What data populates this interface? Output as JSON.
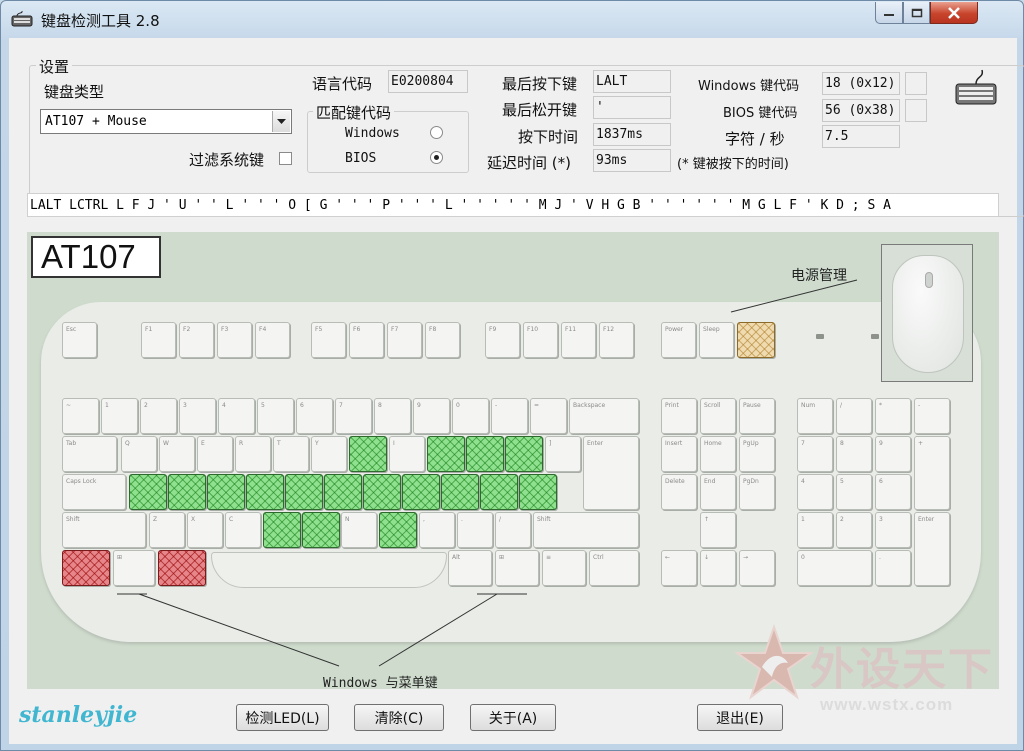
{
  "window": {
    "title": "键盘检测工具 2.8"
  },
  "settings": {
    "legend": "设置",
    "keyboard_type_label": "键盘类型",
    "keyboard_type_value": "AT107 + Mouse",
    "filter_system_keys_label": "过滤系统键",
    "filter_system_keys_checked": false,
    "lang_code_label": "语言代码",
    "lang_code_value": "E0200804",
    "match_legend": "匹配键代码",
    "match_windows_label": "Windows",
    "match_bios_label": "BIOS",
    "match_selected": "BIOS"
  },
  "stats": {
    "last_pressed_label": "最后按下键",
    "last_pressed_value": "LALT",
    "last_released_label": "最后松开键",
    "last_released_value": "'",
    "press_time_label": "按下时间",
    "press_time_value": "1837ms",
    "delay_label": "延迟时间 (*)",
    "delay_value": "93ms",
    "windows_code_label": "Windows 键代码",
    "windows_code_value": "18 (0x12)",
    "bios_code_label": "BIOS 键代码",
    "bios_code_value": "56 (0x38)",
    "cps_label": "字符 / 秒",
    "cps_value": "7.5",
    "note": "(* 键被按下的时间)"
  },
  "log": "LALT LCTRL L F J ' U ' ' L ' ' ' O [ G ' ' ' P ' ' ' L ' ' ' ' ' M J ' V H G B ' ' ' ' ' ' M G L F ' K D ; S A",
  "keyboard": {
    "model_badge": "AT107",
    "power_label": "电源管理",
    "windows_menu_label": "Windows 与菜单键"
  },
  "buttons": {
    "detect_led": "检测LED(L)",
    "clear": "清除(C)",
    "about": "关于(A)",
    "exit": "退出(E)"
  },
  "signature": "stanleyjie",
  "watermark": {
    "brand": "外设天下",
    "url": "www.wstx.com"
  },
  "colors": {
    "pressed_green": "#8fe08f",
    "windows_red": "#e6868a",
    "power_yellow": "#f0dab0"
  }
}
